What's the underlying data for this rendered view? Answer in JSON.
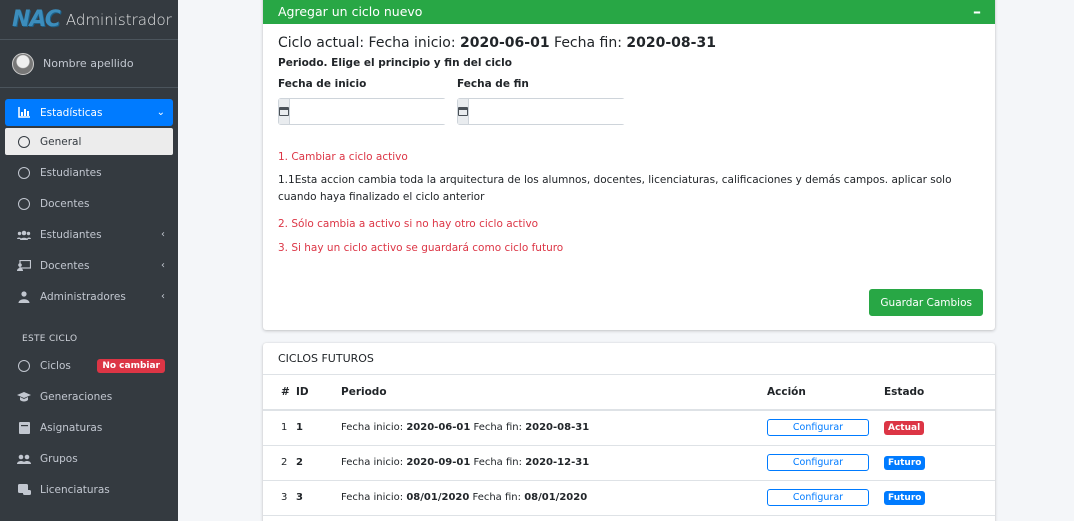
{
  "brand": {
    "logo": "NAC",
    "text": "Administrador"
  },
  "user": {
    "name": "Nombre apellido"
  },
  "sidebar": {
    "items": [
      {
        "label": "Estadísticas"
      },
      {
        "label": "General"
      },
      {
        "label": "Estudiantes"
      },
      {
        "label": "Docentes"
      },
      {
        "label": "Estudiantes"
      },
      {
        "label": "Docentes"
      },
      {
        "label": "Administradores"
      }
    ],
    "section_header": "ESTE CICLO",
    "cycle_items": [
      {
        "label": "Ciclos",
        "badge": "No cambiar"
      },
      {
        "label": "Generaciones"
      },
      {
        "label": "Asignaturas"
      },
      {
        "label": "Grupos"
      },
      {
        "label": "Licenciaturas"
      }
    ]
  },
  "new_cycle": {
    "header": "Agregar un ciclo nuevo",
    "collapse": "–",
    "current_prefix": "Ciclo actual: Fecha inicio: ",
    "current_start": "2020-06-01",
    "current_mid": " Fecha fin: ",
    "current_end": "2020-08-31",
    "period_title": "Periodo. Elige el principio y fin del ciclo",
    "start_label": "Fecha de inicio",
    "end_label": "Fecha de fin",
    "start_value": "",
    "end_value": "",
    "note1": "1. Cambiar a ciclo activo",
    "note1_text": "1.1Esta accion cambia toda la arquitectura de los alumnos, docentes, licenciaturas, calificaciones y demás campos. aplicar solo cuando haya finalizado el ciclo anterior",
    "note2": "2. Sólo cambia a activo si no hay otro ciclo activo",
    "note3": "3. Si hay un ciclo activo se guardará como ciclo futuro",
    "save_label": "Guardar Cambios"
  },
  "future_cycles": {
    "header": "CICLOS FUTUROS",
    "columns": [
      "#",
      "ID",
      "Periodo",
      "Acción",
      "Estado"
    ],
    "rows": [
      {
        "num": "1",
        "id": "1",
        "start_label": "Fecha inicio: ",
        "start": "2020-06-01",
        "end_label": " Fecha fin: ",
        "end": "2020-08-31",
        "action": "Configurar",
        "state": "Actual",
        "state_color": "#dc3545"
      },
      {
        "num": "2",
        "id": "2",
        "start_label": "Fecha inicio: ",
        "start": "2020-09-01",
        "end_label": " Fecha fin: ",
        "end": "2020-12-31",
        "action": "Configurar",
        "state": "Futuro",
        "state_color": "#007bff"
      },
      {
        "num": "3",
        "id": "3",
        "start_label": "Fecha inicio: ",
        "start": "08/01/2020",
        "end_label": " Fecha fin: ",
        "end": "08/01/2020",
        "action": "Configurar",
        "state": "Futuro",
        "state_color": "#007bff"
      }
    ]
  },
  "colors": {
    "primary": "#007bff",
    "success": "#28a745",
    "danger": "#dc3545",
    "sidebar": "#343a40"
  }
}
